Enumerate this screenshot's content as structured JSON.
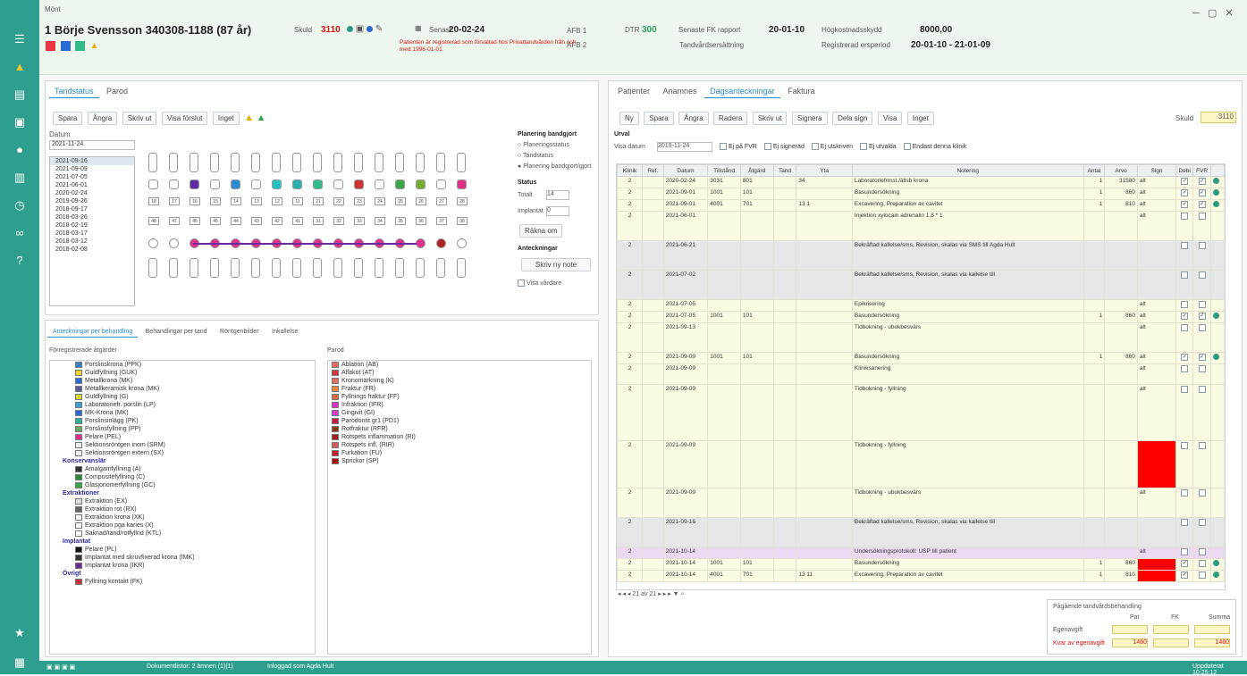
{
  "app": {
    "title": "Mönt"
  },
  "patient": {
    "name": "1 Börje Svensson 340308-1188 (87 år)",
    "saldo_label": "Skuld",
    "saldo_value": "3110",
    "senast_label": "Senast",
    "senast_value": "20-02-24",
    "warning": "Patienten är registrerad som förvaltad hos Privattandvården från och med 1996-01-01"
  },
  "header": {
    "afb1": "AFB 1",
    "afb2": "AFB 2",
    "ovr_label": "DTR",
    "ovr_value": "300",
    "fk_label": "Senaste FK rapport",
    "fk_value": "20-01-10",
    "behandlingsbelopp_label": "Högkostnadsskydd",
    "behandlingsbelopp_value": "8000,00",
    "ersattning_label": "Tandvårdsersättning",
    "period_label": "Registrerad ersperiod",
    "period_value": "20-01-10 - 21-01-09"
  },
  "left": {
    "tabs": [
      "Tandstatus",
      "Parod"
    ],
    "toolbar": [
      "Spara",
      "Ångra",
      "Skriv ut",
      "Visa förslut",
      "Inget"
    ],
    "datum_label": "Datum",
    "datum_value": "2021-11-24",
    "dates": [
      "2021-09-16",
      "2021-09-09",
      "2021-07-05",
      "2021-06-01",
      "2020-02-24",
      "2019-09-26",
      "2018-09-17",
      "2018-03-26",
      "2018-02-19",
      "2018-03-17",
      "2018-03-12",
      "2018-02-08"
    ],
    "planning_title": "Planering bandgjort",
    "planning_opts": [
      "Planeringsstatus",
      "Tandstatus",
      "Planering bandgjort/gjort"
    ],
    "status_title": "Status",
    "status_total": "Totalt",
    "status_total_v": "14",
    "status_implant": "Implantat",
    "status_implant_v": "0",
    "rakna_btn": "Räkna om",
    "anteck_title": "Anteckningar",
    "skriv_btn": "Skriv ny note",
    "ova_label": "Visa vårdare",
    "upper_nums": [
      "18",
      "17",
      "16",
      "15",
      "14",
      "13",
      "12",
      "11",
      "21",
      "22",
      "23",
      "24",
      "25",
      "26",
      "27",
      "28"
    ],
    "lower_nums": [
      "48",
      "47",
      "46",
      "45",
      "44",
      "43",
      "42",
      "41",
      "31",
      "32",
      "33",
      "34",
      "35",
      "36",
      "37",
      "38"
    ],
    "lower_tabs": [
      "Anteckningar per behandling",
      "Behandlingar per tand",
      "Röntgenbilder",
      "Inkallelse"
    ],
    "lower_left_title": "Förregistrerade åtgärder",
    "lower_right_title": "Parod",
    "left_items": [
      "Porslinskrona (PPK)",
      "Guldfyllning (GUK)",
      "Metallkrona (MK)",
      "Metallkeramisk krona (MK)",
      "Guldfyllning (G)",
      "Laboratoriefr. porslin (LP)",
      "MK-Krona (MK)",
      "Porslinsinlägg (PK)",
      "Porslinsfyllning (PP)",
      "Pelare (PEL)",
      "Sektionsröntgen inom (SRM)",
      "Sektionsröntgen extern (SX)"
    ],
    "left_sec1": "Konservanslär",
    "left_items2": [
      "Amalgamfyllning (A)",
      "Compositefyllning (C)",
      "Glasjonomerfyllning (GC)"
    ],
    "left_sec2": "Extraktioner",
    "left_items3": [
      "Extraktion (EX)",
      "Extraktion rot (RX)",
      "Extraktion krona (XK)",
      "Extraktion pga karies (X)",
      "Saknad/tand/rotfyllnd (KTL)"
    ],
    "left_sec3": "Implantat",
    "left_items4": [
      "Pelare (PL)",
      "Implantat med skruvfixerad krona (IMK)",
      "Implantat krona (IKR)"
    ],
    "left_sec4": "Övrigt",
    "left_items5": [
      "Fyllning kontakt (FK)"
    ],
    "right_items": [
      "Ablation (AB)",
      "Alfakot (AT)",
      "Kronomärkning (K)",
      "Fraktur (FR)",
      "Fyllnings fraktur (FF)",
      "Infraktion (IFR)",
      "Gingivit (GI)",
      "Parodontit gr1 (PD1)",
      "Rotfraktur (RFR)",
      "Rotspets inflammation (RI)",
      "Rotspets infl. (RIR)",
      "Furkation (FU)",
      "Sprickor (SP)"
    ]
  },
  "right": {
    "tabs": [
      "Patienter",
      "Anamnes",
      "Dagsanteckningar",
      "Faktura"
    ],
    "toolbar": [
      "Ny",
      "Spara",
      "Ångra",
      "Radera",
      "Skriv ut",
      "Signera",
      "Dela sign",
      "Visa",
      "Inget"
    ],
    "saldo_label": "Skuld",
    "saldo_value": "3110",
    "urval_label": "Urval",
    "visa_datum_label": "Visa datum",
    "visa_datum_value": "2019-11-24",
    "filters": [
      "Ej på FVR",
      "Ej signerad",
      "Ej utskriven",
      "Ej utvalda",
      "Endast denna klinik"
    ],
    "cols": [
      "Klinik",
      "Ref.",
      "Datum",
      "Tillstånd",
      "Åtgärd",
      "Tand",
      "Yta",
      "Notering",
      "Antal",
      "Arvo",
      "Sign",
      "Debi",
      "FVR",
      ""
    ],
    "rows": [
      {
        "t": "y",
        "k": "2",
        "r": "",
        "d": "2020-02-24",
        "ti": "3031",
        "a": "801",
        "ta": "",
        "y": "34",
        "n": "Laboratoriefrmst./ällsb krona",
        "an": "1",
        "ar": "31580",
        "s": "alt",
        "c1": true,
        "c2": true,
        "dot": true
      },
      {
        "t": "y",
        "k": "2",
        "r": "",
        "d": "2021-09-01",
        "ti": "1001",
        "a": "101",
        "ta": "",
        "y": "",
        "n": "Basundersökning",
        "an": "1",
        "ar": "860",
        "s": "alt",
        "c1": true,
        "c2": true,
        "dot": true
      },
      {
        "t": "y",
        "k": "2",
        "r": "",
        "d": "2021-09-01",
        "ti": "4001",
        "a": "701",
        "ta": "",
        "y": "13 1",
        "n": "Excavering, Preparation av cavitet",
        "an": "1",
        "ar": "810",
        "s": "alt",
        "c1": true,
        "c2": true,
        "dot": true
      },
      {
        "t": "y",
        "k": "2",
        "r": "",
        "d": "2021-06-01",
        "ti": "",
        "a": "",
        "ta": "",
        "y": "",
        "n": "Injektion xylocain adrenalin 1,8 * 1",
        "an": "",
        "ar": "",
        "s": "alt",
        "c1": false,
        "c2": false,
        "dot": false
      },
      {
        "t": "g",
        "k": "2",
        "r": "",
        "d": "2021-06-21",
        "ti": "",
        "a": "",
        "ta": "",
        "y": "",
        "n": "Bekräftad kallelse/sms, Revision, skalas via SMS till Agda Hult",
        "an": "",
        "ar": "",
        "s": "",
        "c1": false,
        "c2": false,
        "dot": false
      },
      {
        "t": "g",
        "k": "2",
        "r": "",
        "d": "2021-07-02",
        "ti": "",
        "a": "",
        "ta": "",
        "y": "",
        "n": "Bekräftad kallelse/sms, Revision, skalas via kallelse till",
        "an": "",
        "ar": "",
        "s": "",
        "c1": false,
        "c2": false,
        "dot": false
      },
      {
        "t": "y",
        "k": "2",
        "r": "",
        "d": "2021-07-05",
        "ti": "",
        "a": "",
        "ta": "",
        "y": "",
        "n": "Epikrisering",
        "an": "",
        "ar": "",
        "s": "alt",
        "c1": false,
        "c2": false,
        "dot": false
      },
      {
        "t": "y",
        "k": "2",
        "r": "",
        "d": "2021-07-05",
        "ti": "1001",
        "a": "101",
        "ta": "",
        "y": "",
        "n": "Basundersökning",
        "an": "1",
        "ar": "860",
        "s": "alt",
        "c1": true,
        "c2": true,
        "dot": true
      },
      {
        "t": "y",
        "k": "2",
        "r": "",
        "d": "2021-09-13",
        "ti": "",
        "a": "",
        "ta": "",
        "y": "",
        "n": "Tidbokning - ubokbesvärs",
        "an": "",
        "ar": "",
        "s": "alt",
        "c1": false,
        "c2": false,
        "dot": false
      },
      {
        "t": "y",
        "k": "2",
        "r": "",
        "d": "2021-09-09",
        "ti": "1001",
        "a": "101",
        "ta": "",
        "y": "",
        "n": "Basundersökning",
        "an": "1",
        "ar": "860",
        "s": "alt",
        "c1": true,
        "c2": true,
        "dot": true
      },
      {
        "t": "y",
        "k": "2",
        "r": "",
        "d": "2021-09-09",
        "ti": "",
        "a": "",
        "ta": "",
        "y": "",
        "n": "Kliniksanering",
        "an": "",
        "ar": "",
        "s": "alt",
        "c1": false,
        "c2": false,
        "dot": false
      },
      {
        "t": "y",
        "k": "2",
        "r": "",
        "d": "2021-09-09",
        "ti": "",
        "a": "",
        "ta": "",
        "y": "",
        "n": "Tidbokning - fyllning",
        "an": "",
        "ar": "",
        "s": "alt",
        "c1": false,
        "c2": false,
        "dot": false
      },
      {
        "t": "y",
        "k": "2",
        "r": "",
        "d": "2021-09-09",
        "ti": "",
        "a": "",
        "ta": "",
        "y": "",
        "n": "Tidbokning - fyllning",
        "an": "",
        "ar": "",
        "s": "red",
        "c1": false,
        "c2": false,
        "dot": false
      },
      {
        "t": "y",
        "k": "2",
        "r": "",
        "d": "2021-09-09",
        "ti": "",
        "a": "",
        "ta": "",
        "y": "",
        "n": "Tidbokning - ubokbesvärs",
        "an": "",
        "ar": "",
        "s": "alt",
        "c1": false,
        "c2": false,
        "dot": false
      },
      {
        "t": "g",
        "k": "2",
        "r": "",
        "d": "2021-09-16",
        "ti": "",
        "a": "",
        "ta": "",
        "y": "",
        "n": "Bekräftad kallelse/sms, Revision, skalas via kallelse till",
        "an": "",
        "ar": "",
        "s": "",
        "c1": false,
        "c2": false,
        "dot": false
      },
      {
        "t": "p",
        "k": "2",
        "r": "",
        "d": "2021-10-14",
        "ti": "",
        "a": "",
        "ta": "",
        "y": "",
        "n": "Undersökningsprotokoll: USP till patient",
        "an": "",
        "ar": "",
        "s": "alt",
        "c1": false,
        "c2": false,
        "dot": false
      },
      {
        "t": "y",
        "k": "2",
        "r": "",
        "d": "2021-10-14",
        "ti": "1001",
        "a": "101",
        "ta": "",
        "y": "",
        "n": "Basundersökning",
        "an": "1",
        "ar": "860",
        "s": "red",
        "c1": true,
        "c2": false,
        "dot": true
      },
      {
        "t": "y",
        "k": "2",
        "r": "",
        "d": "2021-10-14",
        "ti": "4001",
        "a": "701",
        "ta": "",
        "y": "13 11",
        "n": "Excavering, Preparation av cavitet",
        "an": "1",
        "ar": "810",
        "s": "red",
        "c1": true,
        "c2": false,
        "dot": true
      }
    ],
    "pager": "21 av 21",
    "summary_title": "Pågående tandvårdsbehandling",
    "sum_cols": [
      "Pat",
      "FK",
      "Summa"
    ],
    "sum_row1": "Egenavgift",
    "sum_row2": "Kvar av egenavgift",
    "sum_v1": "1460",
    "sum_v2": "1460"
  },
  "taskbar": {
    "item1": "Dokumentlistor: 2 ämnen (1)(1)",
    "item2": "Inloggad som Agda Hult",
    "right": "Uppdaterat 10:25:12"
  }
}
